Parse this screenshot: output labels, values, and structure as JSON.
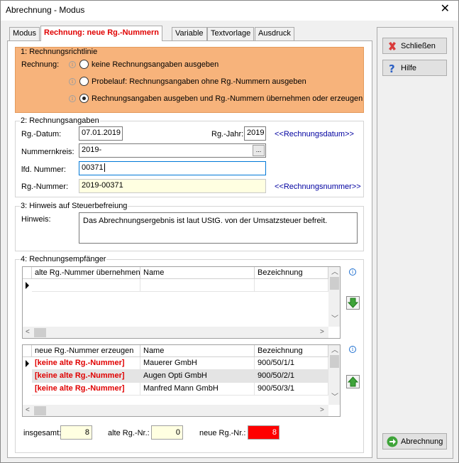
{
  "window": {
    "title": "Abrechnung - Modus"
  },
  "tabs": [
    "Modus",
    "Rechnung: neue Rg.-Nummern",
    "Variable",
    "Textvorlage",
    "Ausdruck"
  ],
  "section1": {
    "title": "1: Rechnungsrichtlinie",
    "label": "Rechnung:",
    "options": [
      "keine Rechnungsangaben ausgeben",
      "Probelauf: Rechnungsangaben ohne Rg.-Nummern ausgeben",
      "Rechnungsangaben ausgeben und Rg.-Nummern übernehmen oder erzeugen"
    ],
    "selected": "Rechnungsangaben ausgeben und Rg.-Nummern übernehmen oder erzeugen"
  },
  "section2": {
    "title": "2: Rechnungsangaben",
    "datum_label": "Rg.-Datum:",
    "datum": "07.01.2019",
    "jahr_label": "Rg.-Jahr:",
    "jahr": "2019",
    "datum_link": "<<Rechnungsdatum>>",
    "kreis_label": "Nummernkreis:",
    "kreis": "2019-",
    "kreis_button": "...",
    "lfd_label": "lfd. Nummer:",
    "lfd": "00371",
    "nummer_label": "Rg.-Nummer:",
    "nummer": "2019-00371",
    "nummer_link": "<<Rechnungsnummer>>"
  },
  "section3": {
    "title": "3: Hinweis auf Steuerbefreiung",
    "label": "Hinweis:",
    "text": "Das Abrechnungsergebnis ist laut UStG. von der Umsatzsteuer befreit."
  },
  "section4": {
    "title": "4: Rechnungsempfänger",
    "grid1": {
      "columns": [
        "alte Rg.-Nummer übernehmen",
        "Name",
        "Bezeichnung"
      ],
      "rows": []
    },
    "grid2": {
      "columns": [
        "neue Rg.-Nummer erzeugen",
        "Name",
        "Bezeichnung"
      ],
      "rows": [
        {
          "nummer": "[keine alte Rg.-Nummer]",
          "name": "Mauerer GmbH",
          "bezeichnung": "900/50/1/1"
        },
        {
          "nummer": "[keine alte Rg.-Nummer]",
          "name": "Augen Opti GmbH",
          "bezeichnung": "900/50/2/1"
        },
        {
          "nummer": "[keine alte Rg.-Nummer]",
          "name": "Manfred Mann GmbH",
          "bezeichnung": "900/50/3/1"
        }
      ]
    },
    "totals": {
      "insgesamt_label": "insgesamt:",
      "insgesamt": "8",
      "alte_label": "alte Rg.-Nr.:",
      "alte": "0",
      "neue_label": "neue Rg.-Nr.:",
      "neue": "8"
    }
  },
  "buttons": {
    "close": "Schließen",
    "help": "Hilfe",
    "billing": "Abrechnung"
  },
  "colors": {
    "section1_bg": "#f7b37b",
    "accent_red": "#e00000",
    "link_blue": "#0000a0"
  }
}
